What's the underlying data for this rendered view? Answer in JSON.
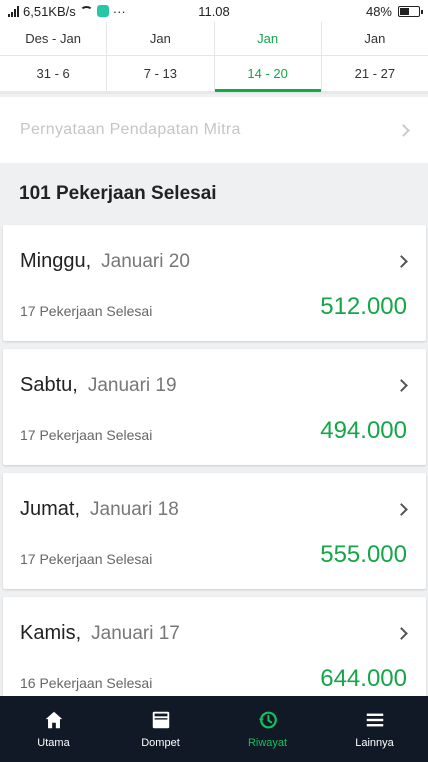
{
  "status_bar": {
    "net_speed": "6,51KB/s",
    "more": "···",
    "time": "11.08",
    "battery": "48%"
  },
  "weeks": [
    {
      "month": "Des - Jan",
      "range": "31 - 6"
    },
    {
      "month": "Jan",
      "range": "7 - 13"
    },
    {
      "month": "Jan",
      "range": "14 - 20",
      "active": true
    },
    {
      "month": "Jan",
      "range": "21 - 27"
    }
  ],
  "statement": {
    "label": "Pernyataan Pendapatan Mitra"
  },
  "summary": {
    "title": "101 Pekerjaan Selesai"
  },
  "days": [
    {
      "day": "Minggu,",
      "date": "Januari 20",
      "jobs": "17 Pekerjaan Selesai",
      "amount": "512.000"
    },
    {
      "day": "Sabtu,",
      "date": "Januari 19",
      "jobs": "17 Pekerjaan Selesai",
      "amount": "494.000"
    },
    {
      "day": "Jumat,",
      "date": "Januari 18",
      "jobs": "17 Pekerjaan Selesai",
      "amount": "555.000"
    },
    {
      "day": "Kamis,",
      "date": "Januari 17",
      "jobs": "16 Pekerjaan Selesai",
      "amount": "644.000"
    }
  ],
  "nav": [
    {
      "label": "Utama",
      "icon": "home-icon"
    },
    {
      "label": "Dompet",
      "icon": "wallet-icon"
    },
    {
      "label": "Riwayat",
      "icon": "history-icon",
      "active": true
    },
    {
      "label": "Lainnya",
      "icon": "menu-icon"
    }
  ],
  "colors": {
    "accent": "#14a648",
    "nav_bg": "#111927",
    "nav_active": "#14c05a"
  }
}
